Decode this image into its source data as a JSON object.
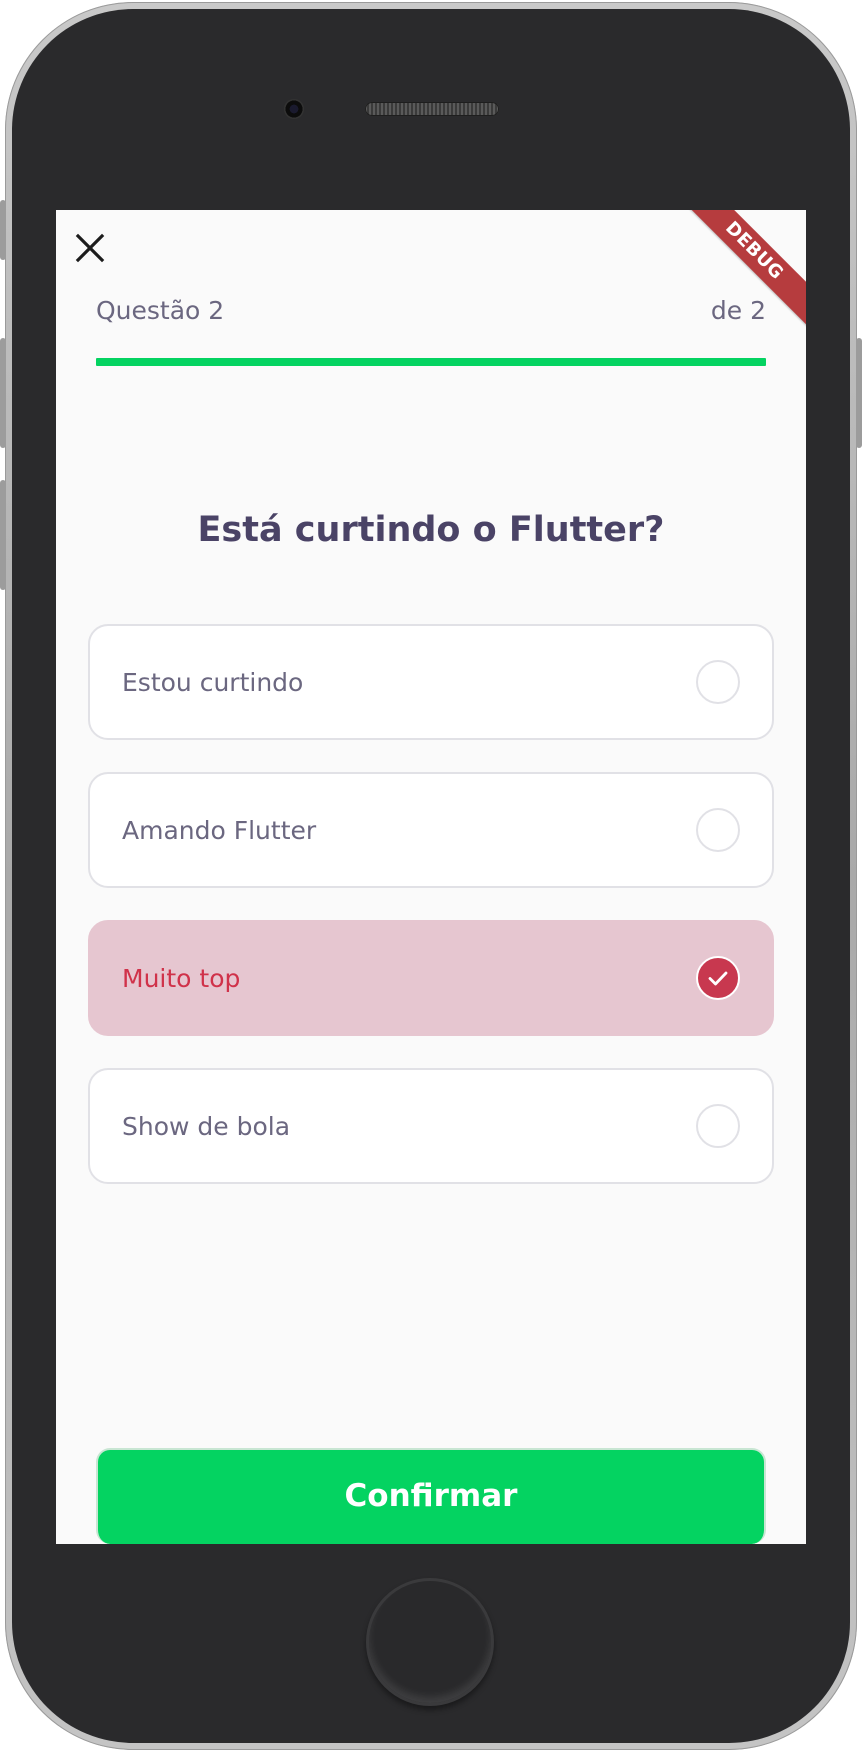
{
  "header": {
    "close_icon": "close-icon",
    "debug_label": "DEBUG",
    "question_counter": "Questão 2",
    "question_total": "de 2",
    "progress_fraction": 1.0,
    "progress_color": "#04d361"
  },
  "question": {
    "title": "Está curtindo o Flutter?"
  },
  "answers": [
    {
      "label": "Estou curtindo",
      "selected": false
    },
    {
      "label": "Amando Flutter",
      "selected": false
    },
    {
      "label": "Muito top",
      "selected": true
    },
    {
      "label": "Show de bola",
      "selected": false
    }
  ],
  "footer": {
    "confirm_label": "Confirmar"
  },
  "colors": {
    "accent_green": "#04d361",
    "selected_bg": "#e6c6d0",
    "selected_text": "#d0324a",
    "check_circle": "#c8384f",
    "title_text": "#4a4366",
    "body_text": "#6b6780"
  }
}
